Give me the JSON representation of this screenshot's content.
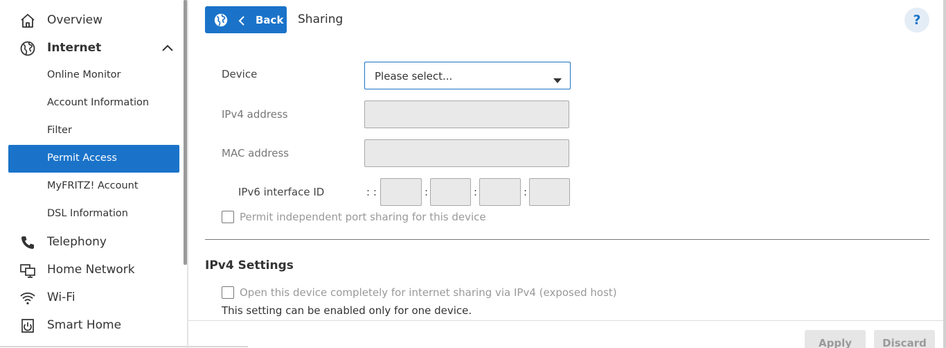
{
  "sidebar": {
    "items": [
      {
        "label": "Overview",
        "icon": "home-icon"
      },
      {
        "label": "Internet",
        "icon": "globe-icon",
        "expanded": true
      },
      {
        "label": "Telephony",
        "icon": "phone-icon"
      },
      {
        "label": "Home Network",
        "icon": "network-icon"
      },
      {
        "label": "Wi-Fi",
        "icon": "wifi-icon"
      },
      {
        "label": "Smart Home",
        "icon": "smart-home-icon"
      }
    ],
    "internet_subitems": [
      {
        "label": "Online Monitor"
      },
      {
        "label": "Account Information"
      },
      {
        "label": "Filter"
      },
      {
        "label": "Permit Access",
        "active": true
      },
      {
        "label": "MyFRITZ! Account"
      },
      {
        "label": "DSL Information"
      }
    ]
  },
  "header": {
    "back_label": "Back",
    "title": "Sharing",
    "help_label": "?"
  },
  "form": {
    "device_label": "Device",
    "device_value": "Please select...",
    "ipv4_label": "IPv4 address",
    "mac_label": "MAC address",
    "ipv6_label": "IPv6 interface ID",
    "ipv6_prefix": ": :",
    "ipv6_separator": ":",
    "port_sharing_label": "Permit independent port sharing for this device"
  },
  "ipv4_settings": {
    "heading": "IPv4 Settings",
    "exposed_host_label": "Open this device completely for internet sharing via IPv4 (exposed host)",
    "hint": "This setting can be enabled only for one device."
  },
  "footer": {
    "apply_label": "Apply",
    "discard_label": "Discard"
  },
  "colors": {
    "accent": "#1a73c9",
    "disabled_field": "#e9e9e9"
  }
}
